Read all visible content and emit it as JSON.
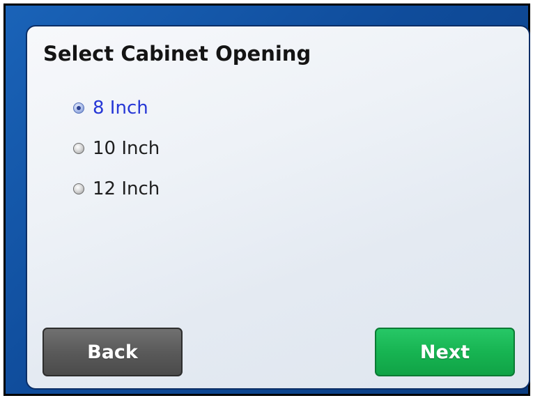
{
  "dialog": {
    "title": "Select Cabinet Opening"
  },
  "options": [
    {
      "label": "8 Inch",
      "selected": true
    },
    {
      "label": "10 Inch",
      "selected": false
    },
    {
      "label": "12 Inch",
      "selected": false
    }
  ],
  "buttons": {
    "back_label": "Back",
    "next_label": "Next"
  },
  "colors": {
    "frame_blue": "#0f4c9b",
    "selected_text": "#2637d6",
    "back_button": "#5a5a5a",
    "next_button": "#17b452"
  }
}
